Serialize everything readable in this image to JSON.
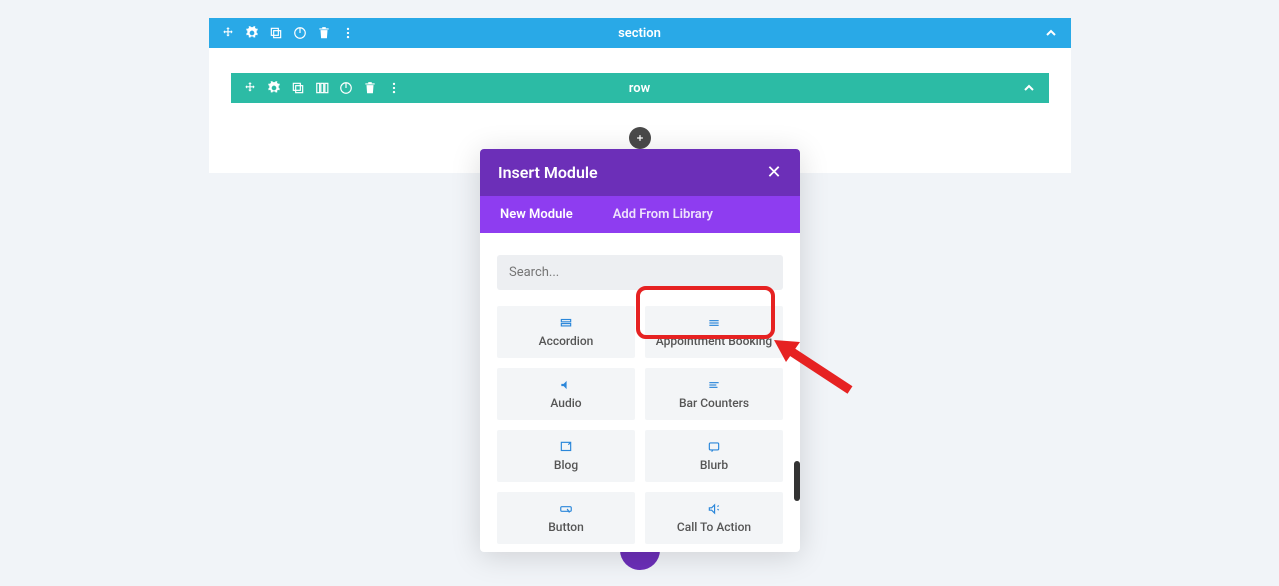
{
  "section": {
    "label": "section"
  },
  "row": {
    "label": "row"
  },
  "modal": {
    "title": "Insert Module",
    "tabs": [
      {
        "label": "New Module",
        "active": true
      },
      {
        "label": "Add From Library",
        "active": false
      }
    ],
    "search_placeholder": "Search...",
    "modules": [
      {
        "label": "Accordion",
        "icon": "accordion-icon"
      },
      {
        "label": "Appointment Booking",
        "icon": "appointment-icon",
        "highlighted": true
      },
      {
        "label": "Audio",
        "icon": "audio-icon"
      },
      {
        "label": "Bar Counters",
        "icon": "bars-icon"
      },
      {
        "label": "Blog",
        "icon": "blog-icon"
      },
      {
        "label": "Blurb",
        "icon": "blurb-icon"
      },
      {
        "label": "Button",
        "icon": "button-icon"
      },
      {
        "label": "Call To Action",
        "icon": "cta-icon"
      }
    ]
  },
  "colors": {
    "section_bar": "#29a9e7",
    "row_bar": "#2cbba5",
    "modal_header": "#6c2fb8",
    "modal_tabs": "#8e3df0",
    "highlight": "#e62222",
    "icon_blue": "#2b87da"
  }
}
